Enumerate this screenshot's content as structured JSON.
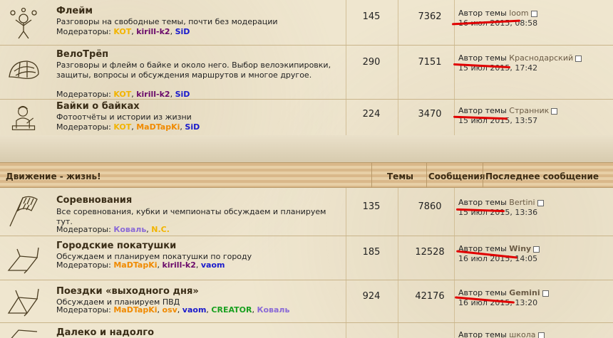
{
  "forums_top": [
    {
      "title": "Флейм",
      "desc": "Разговоры на свободные темы, почти без модерации",
      "mods_label": "Модераторы:",
      "mods": [
        "KOT",
        "kirill-k2",
        "SiD"
      ],
      "topics": "145",
      "posts": "7362",
      "last_author_label": "Автор темы",
      "last_user": "loom",
      "last_date": "16 июл 2015, 08:58",
      "icon": "juggler-icon"
    },
    {
      "title": "ВелоТрёп",
      "desc": "Разговоры и флейм о байке и около него. Выбор велоэкипировки, защиты, вопросы и обсуждения маршрутов и многое другое.",
      "mods_label": "Модераторы:",
      "mods": [
        "KOT",
        "kirill-k2",
        "SiD"
      ],
      "topics": "290",
      "posts": "7151",
      "last_author_label": "Автор темы",
      "last_user": "Краснодарский",
      "last_date": "15 июл 2015, 17:42",
      "icon": "helmet-icon"
    },
    {
      "title": "Байки о байках",
      "desc": "Фотоотчёты и истории из жизни",
      "mods_label": "Модераторы:",
      "mods": [
        "KOT",
        "MaDTapKi",
        "SiD"
      ],
      "topics": "224",
      "posts": "3470",
      "last_author_label": "Автор темы",
      "last_user": "Странник",
      "last_date": "15 июл 2015, 13:57",
      "icon": "writer-icon"
    }
  ],
  "category": {
    "title": "Движение - жизнь!",
    "col_topics": "Темы",
    "col_posts": "Сообщения",
    "col_last": "Последнее сообщение"
  },
  "forums_bottom": [
    {
      "title": "Соревнования",
      "desc": "Все соревнования, кубки и чемпионаты обсуждаем и планируем тут.",
      "mods_label": "Модераторы:",
      "mods": [
        "Коваль",
        "N.C."
      ],
      "topics": "135",
      "posts": "7860",
      "last_author_label": "Автор темы",
      "last_user": "Bertini",
      "last_date": "15 июл 2015, 13:36",
      "icon": "flag-icon"
    },
    {
      "title": "Городские покатушки",
      "desc": "Обсуждаем и планируем покатушки по городу",
      "mods_label": "Модераторы:",
      "mods": [
        "MaDTapKi",
        "kirill-k2",
        "vaom"
      ],
      "topics": "185",
      "posts": "12528",
      "last_author_label": "Автор темы",
      "last_user": "Winy",
      "last_date": "16 июл 2015, 14:05",
      "icon": "bike-frame-icon"
    },
    {
      "title": "Поездки «выходного дня»",
      "desc": "Обсуждаем и планируем ПВД",
      "mods_label": "Модераторы:",
      "mods": [
        "MaDTapKi",
        "osv",
        "vaom",
        "CREATOR",
        "Коваль"
      ],
      "topics": "924",
      "posts": "42176",
      "last_author_label": "Автор темы",
      "last_user": "Gemini",
      "last_date": "16 июл 2015, 13:20",
      "icon": "bike-frame-icon"
    },
    {
      "title": "Далеко и надолго",
      "last_author_label": "Автор темы",
      "last_user": "школа",
      "icon": "bike-frame-icon"
    }
  ]
}
